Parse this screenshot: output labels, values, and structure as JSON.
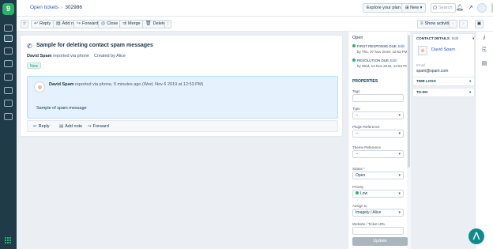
{
  "app": {
    "logo_letter": "9"
  },
  "breadcrumb": {
    "parent": "Open tickets",
    "ticket_id": "302986"
  },
  "header": {
    "explore": "Explore your plan",
    "new": "New",
    "search_placeholder": "Search",
    "user_initial": "A"
  },
  "toolbar": {
    "reply": "Reply",
    "add_note": "Add note",
    "forward": "Forward",
    "close": "Close",
    "merge": "Merge",
    "delete": "Delete",
    "more": "⋮",
    "show_activities": "Show activities"
  },
  "ticket": {
    "subject": "Sample for deleting contact spam messages",
    "requester": "David Spam",
    "reported_via": "reported via phone",
    "created_by": "Created by Alice",
    "badge": "New",
    "message": {
      "author": "David Spam",
      "meta": "reported via phone, 5 minutes ago (Wed, Nov 6 2019 at 12:53 PM)",
      "body": "Sample of spam message"
    },
    "actions": {
      "reply": "Reply",
      "add_note": "Add note",
      "forward": "Forward"
    }
  },
  "properties": {
    "status_heading": "Open",
    "first_response": {
      "label": "FIRST RESPONSE DUE",
      "edit": "Edit",
      "date": "by Thu, 07 Nov 2019, 12:53 PM"
    },
    "resolution": {
      "label": "RESOLUTION DUE",
      "edit": "Edit",
      "date": "by Wed, 13 Nov 2019, 12:53 PM"
    },
    "title": "PROPERTIES",
    "fields": {
      "tags": {
        "label": "Tags",
        "value": ""
      },
      "type": {
        "label": "Type",
        "value": "--"
      },
      "plugin": {
        "label": "Plugin Reference",
        "value": "--"
      },
      "theme": {
        "label": "Theme Reference",
        "value": "--"
      },
      "status": {
        "label": "Status",
        "value": "Open"
      },
      "priority": {
        "label": "Priority",
        "value": "Low"
      },
      "assign": {
        "label": "Assign to",
        "value": "Imagely / Alice"
      },
      "website": {
        "label": "Website / Ticket URL",
        "value": ""
      }
    },
    "update": "Update"
  },
  "contact": {
    "title": "CONTACT DETAILS",
    "edit": "Edit",
    "name": "David Spam",
    "email_label": "Email",
    "email": "spam@spam.com",
    "time_logs": "TIME LOGS",
    "todo": "TO-DO"
  },
  "colors": {
    "nav_bg": "#1f3a48",
    "brand_green": "#29b16a",
    "link_blue": "#2c5cc5",
    "message_bg": "#e5f2fd",
    "fab_teal": "#0f8b8d"
  }
}
